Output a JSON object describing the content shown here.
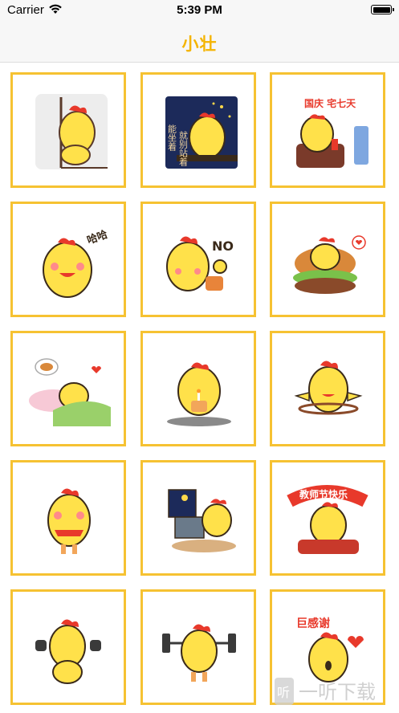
{
  "status": {
    "carrier": "Carrier",
    "time": "5:39 PM"
  },
  "nav": {
    "title": "小壮"
  },
  "stickers": [
    {
      "name": "peek-wall"
    },
    {
      "name": "night-sitting",
      "text": "能 坐着 就 别 站着"
    },
    {
      "name": "national-holiday",
      "text": "国庆 宅七天"
    },
    {
      "name": "laughing",
      "text": "哈哈"
    },
    {
      "name": "no-gesture",
      "text": "NO"
    },
    {
      "name": "burger"
    },
    {
      "name": "sleeping-dream"
    },
    {
      "name": "birthday-cake"
    },
    {
      "name": "hula-hoop"
    },
    {
      "name": "scarf-standing"
    },
    {
      "name": "computer-desk"
    },
    {
      "name": "teachers-day",
      "text": "教师节快乐"
    },
    {
      "name": "dumbbells"
    },
    {
      "name": "barbell"
    },
    {
      "name": "thank-you",
      "text": "巨感谢"
    }
  ],
  "watermark": {
    "text": "一听下载",
    "mark": "听"
  }
}
